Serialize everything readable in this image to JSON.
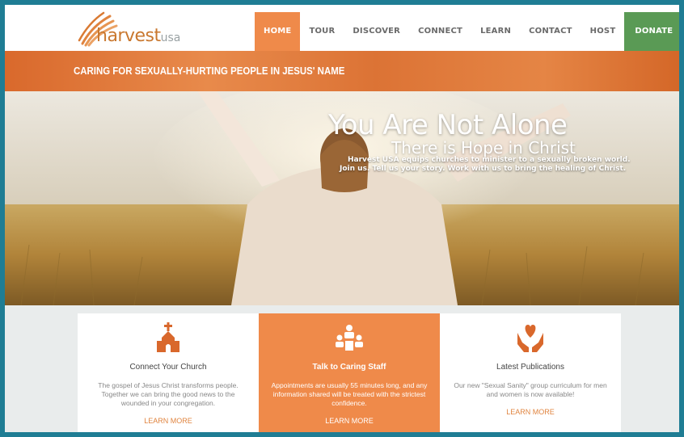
{
  "nav": {
    "logo_word": "harvest",
    "logo_suffix": "usa",
    "items": [
      {
        "label": "HOME"
      },
      {
        "label": "TOUR"
      },
      {
        "label": "DISCOVER"
      },
      {
        "label": "CONNECT"
      },
      {
        "label": "LEARN"
      },
      {
        "label": "CONTACT"
      },
      {
        "label": "HOST"
      },
      {
        "label": "DONATE"
      }
    ],
    "active_index": 0,
    "colors": {
      "active": "#ef8a4a",
      "donate": "#5a9a55"
    }
  },
  "tagline": "CARING FOR SEXUALLY-HURTING PEOPLE IN JESUS' NAME",
  "hero": {
    "heading": "You Are Not Alone",
    "subheading": "There is Hope in Christ",
    "line1": "Harvest USA equips churches to minister to a sexually broken world.",
    "line2": "Join us. Tell us your story. Work with us to bring the healing of Christ."
  },
  "cards": [
    {
      "icon": "church-icon",
      "title": "Connect Your Church",
      "body": "The gospel of Jesus Christ transforms people. Together we can bring the good news to the wounded in your congregation.",
      "link": "LEARN MORE"
    },
    {
      "icon": "people-group-icon",
      "title": "Talk to Caring Staff",
      "body": "Appointments are usually 55 minutes long, and any information shared will be treated with the strictest confidence.",
      "link": "LEARN MORE"
    },
    {
      "icon": "heart-hands-icon",
      "title": "Latest Publications",
      "body": "Our new \"Sexual Sanity\" group curriculum for men and women is now available!",
      "link": "LEARN MORE"
    }
  ]
}
